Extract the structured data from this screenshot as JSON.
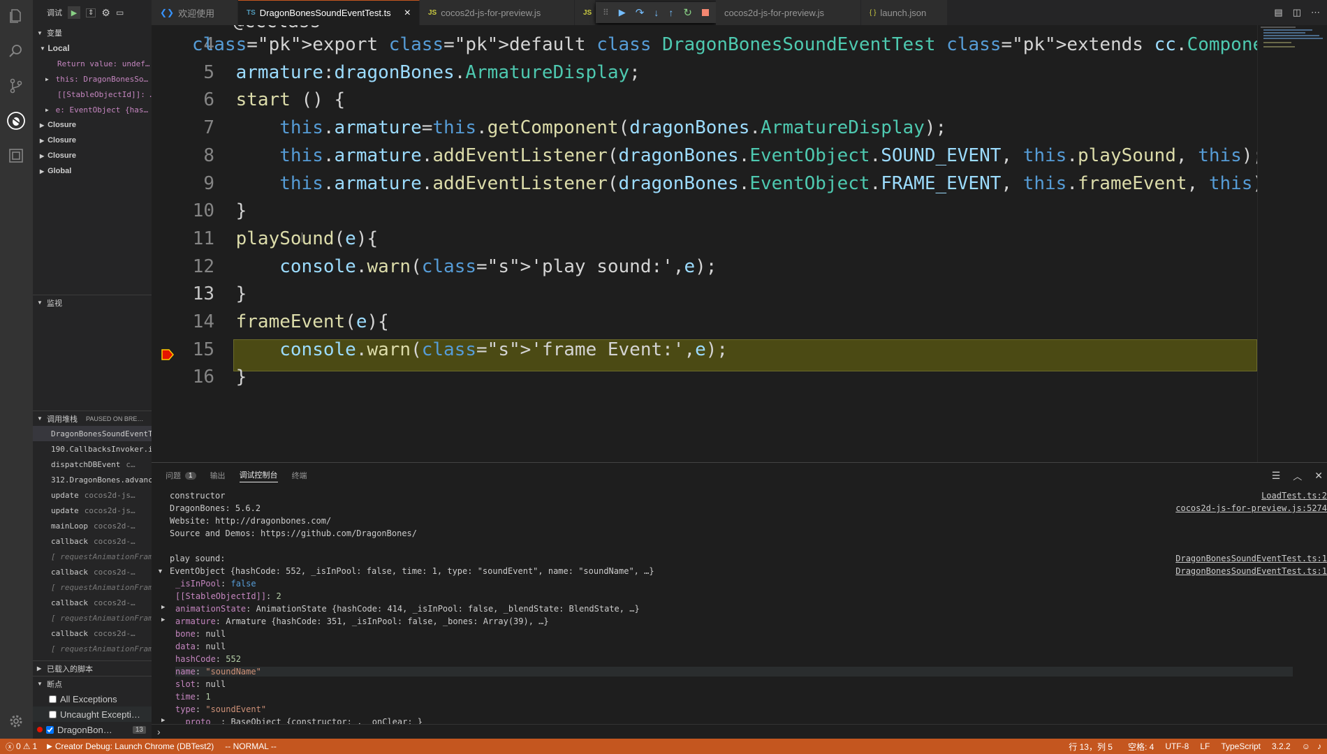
{
  "activity": {
    "icons": [
      "files-icon",
      "search-icon",
      "source-control-icon",
      "debug-icon",
      "extensions-icon",
      "settings-gear-icon"
    ]
  },
  "debug": {
    "label": "调试"
  },
  "variables": {
    "title": "变量",
    "local": "Local",
    "return_value": "Return value: undef…",
    "this": "this: DragonBonesSo…",
    "stable": "[[StableObjectId]]: …",
    "e": "e: EventObject {has…",
    "closures": [
      "Closure",
      "Closure",
      "Closure"
    ],
    "global": "Global"
  },
  "watch": {
    "title": "监视"
  },
  "callstack": {
    "title": "调用堆栈",
    "status": "PAUSED ON BRE…",
    "frames": [
      {
        "name": "DragonBonesSoundEventT",
        "file": ""
      },
      {
        "name": "190.CallbacksInvoker.i",
        "file": ""
      },
      {
        "name": "dispatchDBEvent",
        "file": "c…"
      },
      {
        "name": "312.DragonBones.advanc",
        "file": ""
      },
      {
        "name": "update",
        "file": "cocos2d-js…"
      },
      {
        "name": "update",
        "file": "cocos2d-js…"
      },
      {
        "name": "mainLoop",
        "file": "cocos2d-…"
      },
      {
        "name": "callback",
        "file": "cocos2d-…"
      },
      {
        "name": "[ requestAnimationFram",
        "file": ""
      },
      {
        "name": "callback",
        "file": "cocos2d-…"
      },
      {
        "name": "[ requestAnimationFram",
        "file": ""
      },
      {
        "name": "callback",
        "file": "cocos2d-…"
      },
      {
        "name": "[ requestAnimationFram",
        "file": ""
      },
      {
        "name": "callback",
        "file": "cocos2d-…"
      },
      {
        "name": "[ requestAnimationFram",
        "file": ""
      }
    ]
  },
  "scripts": {
    "title": "已载入的脚本"
  },
  "breakpoints": {
    "title": "断点",
    "items": [
      {
        "label": "All Exceptions",
        "checked": false
      },
      {
        "label": "Uncaught Excepti…",
        "checked": false
      },
      {
        "label": "DragonBon…",
        "checked": true,
        "count": "13"
      }
    ]
  },
  "tabs": [
    {
      "badge": "",
      "label": "欢迎使用"
    },
    {
      "badge": "TS",
      "label": "DragonBonesSoundEventTest.ts",
      "close": "×"
    },
    {
      "badge": "JS",
      "label": "cocos2d-js-for-preview.js"
    },
    {
      "badge": "JS",
      "label": ""
    },
    {
      "badge": "",
      "label": "cocos2d-js-for-preview.js"
    },
    {
      "badge": "{ }",
      "label": "launch.json"
    }
  ],
  "editor": {
    "partial_top": "@ccclass",
    "lines": [
      {
        "n": "4",
        "text": "export default class DragonBonesSoundEventTest extends cc.Component {"
      },
      {
        "n": "5",
        "text": "    armature:dragonBones.ArmatureDisplay;"
      },
      {
        "n": "6",
        "text": "    start () {"
      },
      {
        "n": "7",
        "text": "        this.armature=this.getComponent(dragonBones.ArmatureDisplay);"
      },
      {
        "n": "8",
        "text": "        this.armature.addEventListener(dragonBones.EventObject.SOUND_EVENT, this.playSound, this);"
      },
      {
        "n": "9",
        "text": "        this.armature.addEventListener(dragonBones.EventObject.FRAME_EVENT, this.frameEvent, this);"
      },
      {
        "n": "10",
        "text": "    }"
      },
      {
        "n": "11",
        "text": "    playSound(e){"
      },
      {
        "n": "12",
        "text": "        console.warn('play sound:',e);"
      },
      {
        "n": "13",
        "text": "    }"
      },
      {
        "n": "14",
        "text": "    frameEvent(e){"
      },
      {
        "n": "15",
        "text": "        console.warn('frame Event:',e);"
      },
      {
        "n": "16",
        "text": "    }"
      }
    ]
  },
  "panel": {
    "tabs": [
      "问题",
      "输出",
      "调试控制台",
      "终端"
    ],
    "problem_count": "1",
    "active_tab": "调试控制台"
  },
  "console": {
    "lines": [
      {
        "text": "constructor",
        "src": "LoadTest.ts:2"
      },
      {
        "text": "DragonBones: 5.6.2",
        "src": "cocos2d-js-for-preview.js:5274"
      },
      {
        "text": "Website: http://dragonbones.com/",
        "src": ""
      },
      {
        "text": "Source and Demos: https://github.com/DragonBones/",
        "src": ""
      },
      {
        "text": "",
        "src": ""
      },
      {
        "text": "play sound:",
        "src": "DragonBonesSoundEventTest.ts:1"
      },
      {
        "text": "EventObject {hashCode: 552, _isInPool: false, time: 1, type: \"soundEvent\", name: \"soundName\", …}",
        "src": "DragonBonesSoundEventTest.ts:1"
      }
    ],
    "props": [
      {
        "k": "_isInPool",
        "v": "false",
        "arrow": false
      },
      {
        "k": "[[StableObjectId]]",
        "v": "2",
        "arrow": false
      },
      {
        "k": "animationState",
        "v": "AnimationState {hashCode: 414, _isInPool: false, _blendState: BlendState, …}",
        "arrow": true
      },
      {
        "k": "armature",
        "v": "Armature {hashCode: 351, _isInPool: false, _bones: Array(39), …}",
        "arrow": true
      },
      {
        "k": "bone",
        "v": "null",
        "arrow": false
      },
      {
        "k": "data",
        "v": "null",
        "arrow": false
      },
      {
        "k": "hashCode",
        "v": "552",
        "arrow": false
      },
      {
        "k": "name",
        "v": "\"soundName\"",
        "arrow": false
      },
      {
        "k": "slot",
        "v": "null",
        "arrow": false
      },
      {
        "k": "time",
        "v": "1",
        "arrow": false
      },
      {
        "k": "type",
        "v": "\"soundEvent\"",
        "arrow": false
      },
      {
        "k": "__proto__",
        "v": "BaseObject {constructor: , _onClear: }",
        "arrow": true
      }
    ],
    "prompt": "›"
  },
  "status": {
    "errors": "0",
    "warnings": "1",
    "debug": "Creator Debug: Launch Chrome (DBTest2)",
    "mode": "-- NORMAL --",
    "position": "行 13，列 5",
    "spaces": "空格: 4",
    "encoding": "UTF-8",
    "eol": "LF",
    "language": "TypeScript",
    "version": "3.2.2"
  },
  "colors": {
    "statusbar": "#c4561f",
    "highlight": "#4b4a14",
    "accent": "#007acc"
  }
}
